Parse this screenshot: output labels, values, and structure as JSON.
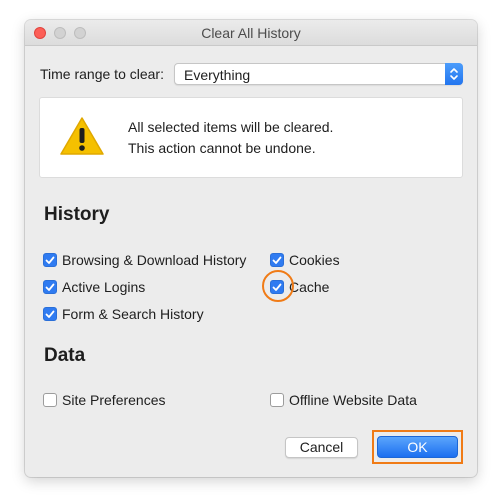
{
  "window": {
    "title": "Clear All History"
  },
  "time_range": {
    "label": "Time range to clear:",
    "value": "Everything"
  },
  "warning": {
    "line1": "All selected items will be cleared.",
    "line2": "This action cannot be undone."
  },
  "history": {
    "title": "History",
    "items": [
      {
        "label": "Browsing & Download History",
        "checked": true
      },
      {
        "label": "Cookies",
        "checked": true
      },
      {
        "label": "Active Logins",
        "checked": true
      },
      {
        "label": "Cache",
        "checked": true
      },
      {
        "label": "Form & Search History",
        "checked": true
      }
    ]
  },
  "data": {
    "title": "Data",
    "items": [
      {
        "label": "Site Preferences",
        "checked": false
      },
      {
        "label": "Offline Website Data",
        "checked": false
      }
    ]
  },
  "buttons": {
    "cancel": "Cancel",
    "ok": "OK"
  },
  "colors": {
    "accent": "#2f7bf1",
    "highlight": "#f07b16",
    "warning": "#f5c000"
  },
  "icons": {
    "close": "close-dot-icon",
    "minimize": "minimize-dot-icon",
    "maximize": "maximize-dot-icon",
    "select": "up-down-chevron-icon",
    "warning": "warning-triangle-icon",
    "checkmark": "checkmark-icon"
  }
}
